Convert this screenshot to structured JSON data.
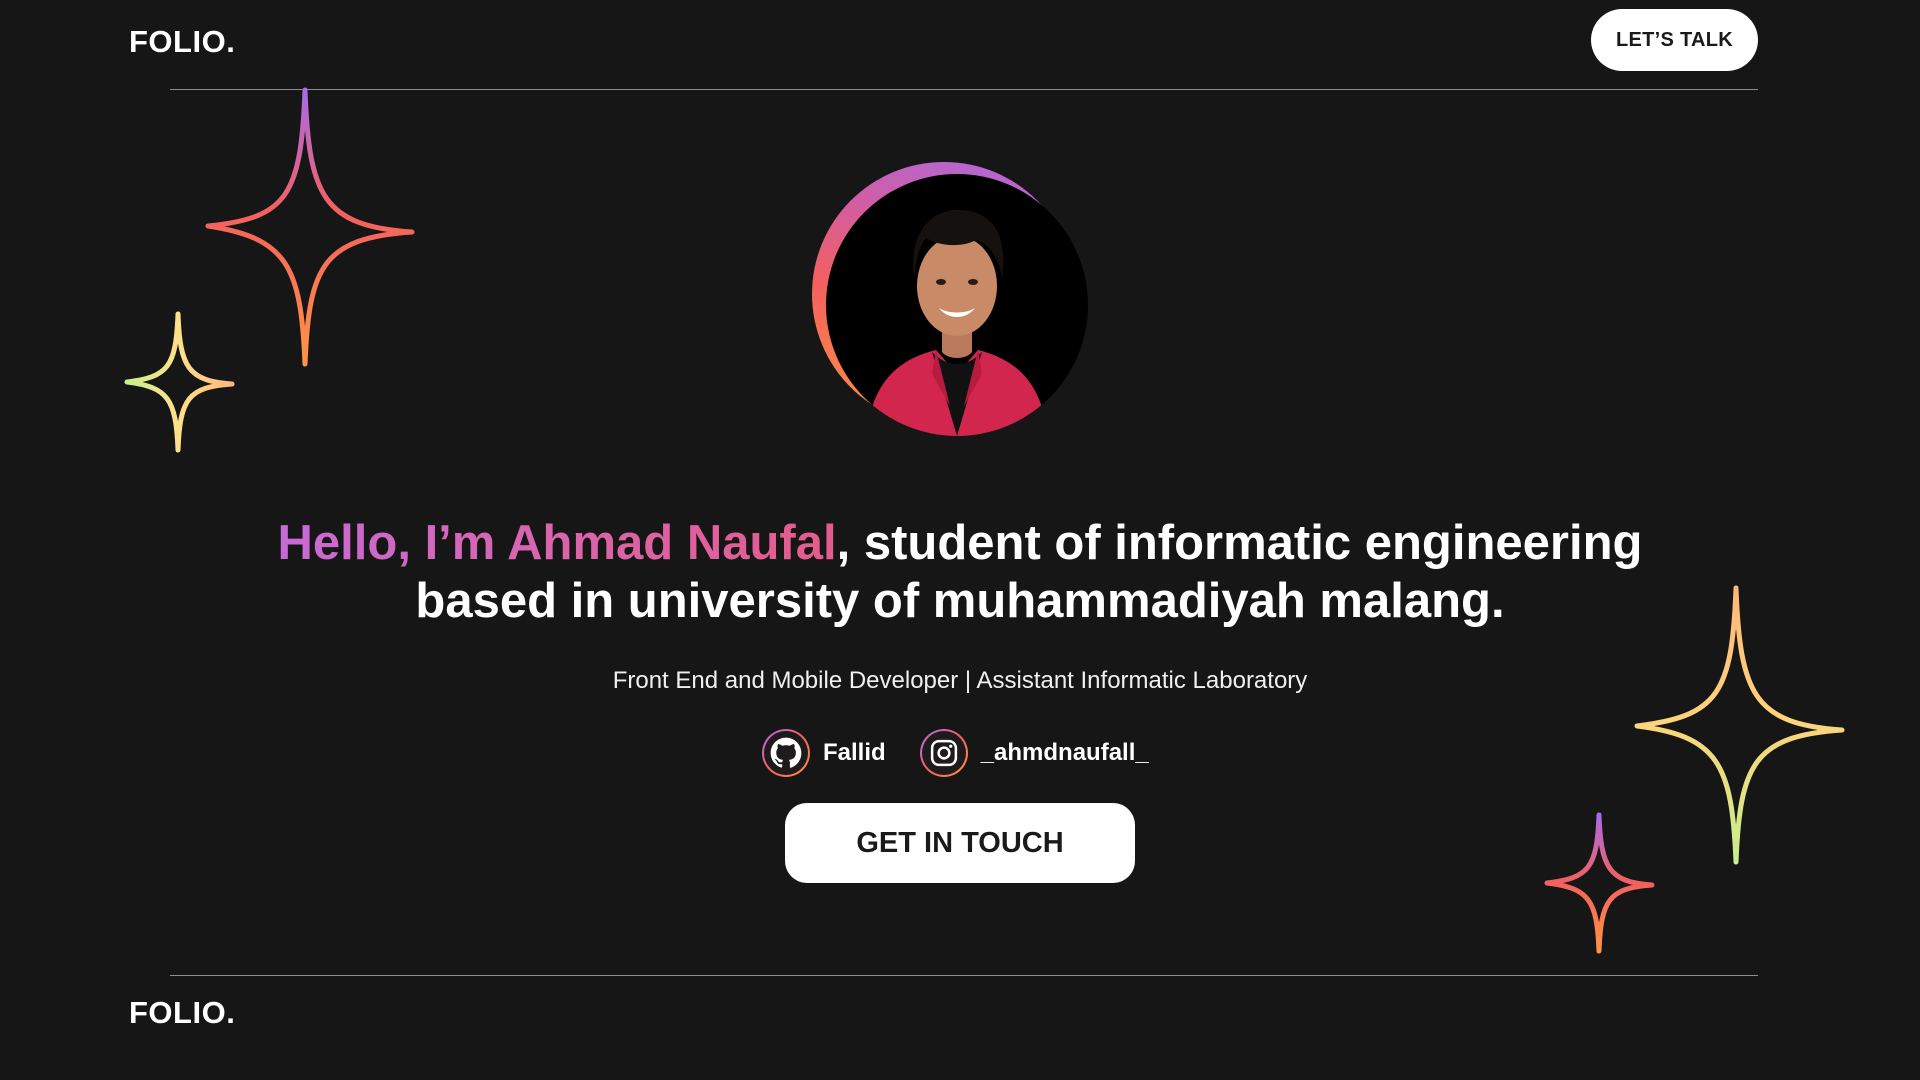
{
  "header": {
    "logo": "FOLIO.",
    "talk_button": "LET’S TALK"
  },
  "hero": {
    "headline_highlight": "Hello, I’m Ahmad Naufal",
    "headline_rest_line1": ", student of informatic engineering",
    "headline_line2": "based in university of muhammadiyah malang.",
    "subtitle": "Front End and Mobile Developer | Assistant Informatic Laboratory",
    "socials": [
      {
        "icon": "github-icon",
        "label": "Fallid"
      },
      {
        "icon": "instagram-icon",
        "label": "_ahmdnaufall_"
      }
    ],
    "cta": "GET IN TOUCH"
  },
  "footer": {
    "logo": "FOLIO."
  },
  "colors": {
    "background": "#171616",
    "gradient_purple": "#a96be8",
    "gradient_pink": "#f4605e",
    "gradient_orange": "#ff9544",
    "gradient_yellow": "#ffd27a",
    "gradient_green": "#c8f08a"
  }
}
